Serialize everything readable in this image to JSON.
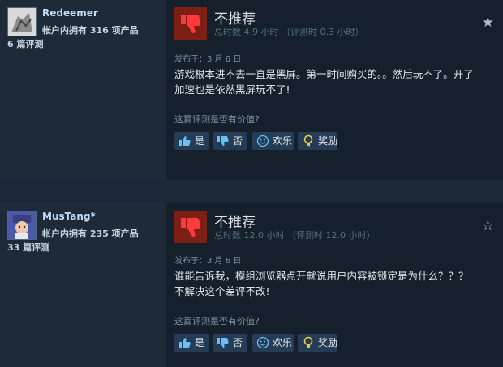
{
  "reviews": [
    {
      "username": "Redeemer",
      "products_owned": "帐户内拥有 316 项产品",
      "review_count": "6 篇评测",
      "recommendation": "不推荐",
      "hours": "总时数 4.9 小时 （评测时 0.3 小时）",
      "posted": "发布于：3 月 6 日",
      "content_lines": [
        "游戏根本进不去一直是黑屏。第一时间购买的。。然后玩不了。开了",
        "加速也是依然黑屏玩不了!"
      ],
      "helpful_question": "这篇评测是否有价值?",
      "buttons": {
        "yes": "是",
        "no": "否",
        "funny": "欢乐",
        "award": "奖励"
      },
      "star": "filled"
    },
    {
      "username": "MusTang*",
      "products_owned": "帐户内拥有 235 项产品",
      "review_count": "33 篇评测",
      "recommendation": "不推荐",
      "hours": "总时数 12.0 小时 （评测时 12.0 小时）",
      "posted": "发布于：3 月 6 日",
      "content_lines": [
        "谁能告诉我，模组浏览器点开就说用户内容被锁定是为什么？？？",
        "不解决这个差评不改!"
      ],
      "helpful_question": "这篇评测是否有价值?",
      "buttons": {
        "yes": "是",
        "no": "否",
        "funny": "欢乐",
        "award": "奖励"
      },
      "star": "empty"
    }
  ],
  "colors": {
    "page_bg": "#1b2838",
    "review_bg": "#16202d",
    "not_recommended_box": "#7e1f16",
    "button_bg": "#243c55"
  }
}
